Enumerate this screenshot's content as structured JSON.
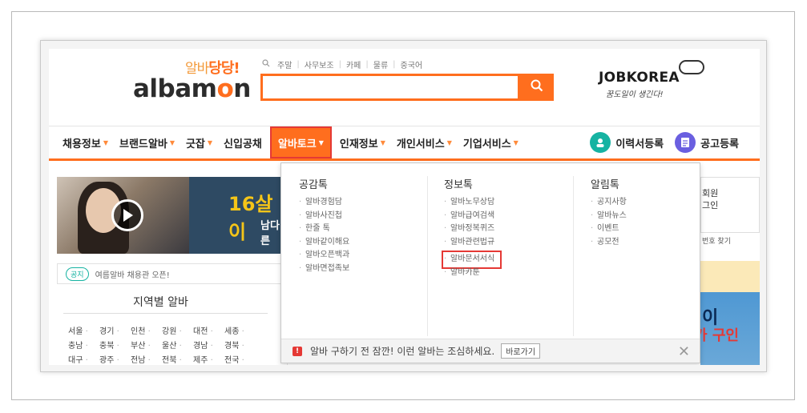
{
  "header": {
    "logo_tag": "알바",
    "logo_tag_bold": "당당!",
    "logo_pre": "albam",
    "logo_o": "o",
    "logo_post": "n",
    "quick_links": [
      "주말",
      "사무보조",
      "카페",
      "물류",
      "중국어"
    ],
    "search_placeholder": "",
    "jobkorea": "JOBKOREA",
    "jobkorea_slogan": "꿈도일이 생긴다!"
  },
  "nav": {
    "items": [
      "채용정보",
      "브랜드알바",
      "긋잡",
      "신입공채",
      "알바토크",
      "인재정보",
      "개인서비스",
      "기업서비스"
    ],
    "resume_label": "이력서등록",
    "post_label": "공고등록"
  },
  "banner": {
    "title": "16살이",
    "subtitle": "남다른"
  },
  "notice": {
    "badge": "공지",
    "text": "여름알바 채용관 오픈!"
  },
  "region": {
    "title": "지역별 알바",
    "cities": [
      "서울",
      "경기",
      "인천",
      "강원",
      "대전",
      "세종",
      "충남",
      "충북",
      "부산",
      "울산",
      "경남",
      "경북",
      "대구",
      "광주",
      "전남",
      "전북",
      "제주",
      "전국"
    ]
  },
  "dropdown": {
    "columns": [
      {
        "title": "공감톡",
        "items": [
          "알바경험담",
          "알바사진첩",
          "한줄 톡",
          "알바같이해요",
          "알바오픈백과",
          "알바면접족보"
        ]
      },
      {
        "title": "정보톡",
        "items": [
          "알바노무상담",
          "알바급여검색",
          "알바정복퀴즈",
          "알바관련법규",
          "알바문서서식",
          "알바카툰"
        ]
      },
      {
        "title": "알림톡",
        "items": [
          "공지사항",
          "알바뉴스",
          "이벤트",
          "공모전"
        ]
      }
    ],
    "highlight_item": "알바문서서식",
    "bottom_text": "알바 구하기 전 잠깐! 이런 알바는 조심하세요.",
    "bottom_button": "바로가기"
  },
  "right": {
    "member_line1": "회원",
    "member_line2": "그인",
    "find_text": "번호 찾기",
    "ad_line1": "이",
    "ad_line2": "가 구인"
  },
  "colors": {
    "brand": "#ff6e1e",
    "highlight": "#e53935",
    "teal": "#16b3a2",
    "purple": "#6a5fe0"
  },
  "icons": [
    "search-icon",
    "play-icon",
    "resume-person-icon",
    "document-icon",
    "warning-icon",
    "close-icon",
    "chevron-down-icon"
  ]
}
